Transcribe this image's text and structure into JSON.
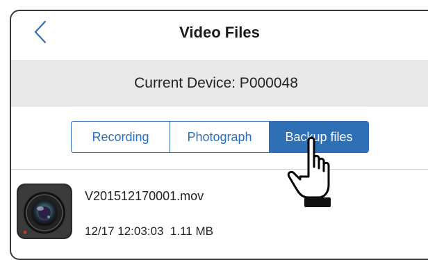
{
  "header": {
    "title": "Video Files",
    "back_icon": "chevron-left-icon"
  },
  "device": {
    "label": "Current Device: P000048"
  },
  "tabs": [
    {
      "label": "Recording",
      "active": false
    },
    {
      "label": "Photograph",
      "active": false
    },
    {
      "label": "Backup files",
      "active": true
    }
  ],
  "files": [
    {
      "name": "V201512170001.mov",
      "date_time": "12/17 12:03:03",
      "size": "1.11 MB",
      "thumbnail_icon": "camera-lens-icon"
    }
  ],
  "colors": {
    "accent": "#2f6fb6",
    "device_bar_bg": "#e9e9e9",
    "text": "#222222"
  }
}
